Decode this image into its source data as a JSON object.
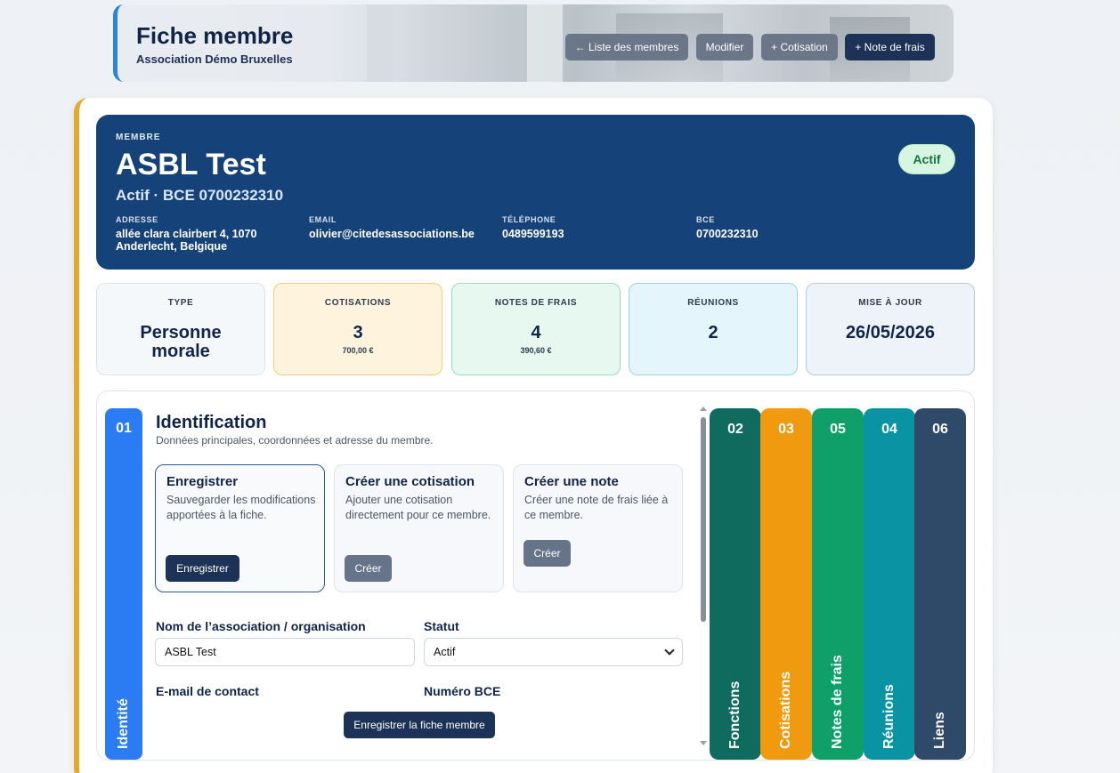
{
  "header": {
    "title": "Fiche membre",
    "subtitle": "Association Démo Bruxelles",
    "buttons": {
      "back": "← Liste des membres",
      "edit": "Modifier",
      "add_cotisation": "+ Cotisation",
      "add_note": "+ Note de frais"
    }
  },
  "member": {
    "kicker": "MEMBRE",
    "name": "ASBL Test",
    "subtitle": "Actif · BCE 0700232310",
    "badge": "Actif",
    "fields": {
      "address_label": "ADRESSE",
      "address_value": "allée clara clairbert 4, 1070 Anderlecht, Belgique",
      "email_label": "EMAIL",
      "email_value": "olivier@citedesassociations.be",
      "phone_label": "TÉLÉPHONE",
      "phone_value": "0489599193",
      "bce_label": "BCE",
      "bce_value": "0700232310"
    }
  },
  "stats": {
    "type_label": "TYPE",
    "type_value": "Personne morale",
    "cotisations_label": "COTISATIONS",
    "cotisations_value": "3",
    "cotisations_sub": "700,00 €",
    "notes_label": "NOTES DE FRAIS",
    "notes_value": "4",
    "notes_sub": "390,60 €",
    "reunions_label": "RÉUNIONS",
    "reunions_value": "2",
    "update_label": "MISE À JOUR",
    "update_value": "26/05/2026"
  },
  "section": {
    "tab_number": "01",
    "tab_label": "Identité",
    "title": "Identification",
    "description": "Données principales, coordonnées et adresse du membre.",
    "actions": {
      "save_title": "Enregistrer",
      "save_desc": "Sauvegarder les modifications apportées à la fiche.",
      "save_button": "Enregistrer",
      "cotisation_title": "Créer une cotisation",
      "cotisation_desc": "Ajouter une cotisation directement pour ce membre.",
      "cotisation_button": "Créer",
      "note_title": "Créer une note",
      "note_desc": "Créer une note de frais liée à ce membre.",
      "note_button": "Créer"
    },
    "form": {
      "org_label": "Nom de l’association / organisation",
      "org_value": "ASBL Test",
      "status_label": "Statut",
      "status_value": "Actif",
      "email_label": "E-mail de contact",
      "bce_label": "Numéro BCE",
      "submit": "Enregistrer la fiche membre"
    }
  },
  "side_tabs": [
    {
      "number": "02",
      "label": "Fonctions",
      "color": "#0f6b5e"
    },
    {
      "number": "03",
      "label": "Cotisations",
      "color": "#f09a10"
    },
    {
      "number": "05",
      "label": "Notes de frais",
      "color": "#0ea068"
    },
    {
      "number": "04",
      "label": "Réunions",
      "color": "#0a93a3"
    },
    {
      "number": "06",
      "label": "Liens",
      "color": "#2f4a69"
    }
  ],
  "colors": {
    "hero": "#16427a",
    "accent_left": "#e5a82a",
    "identity_tab": "#2b7bf2"
  }
}
